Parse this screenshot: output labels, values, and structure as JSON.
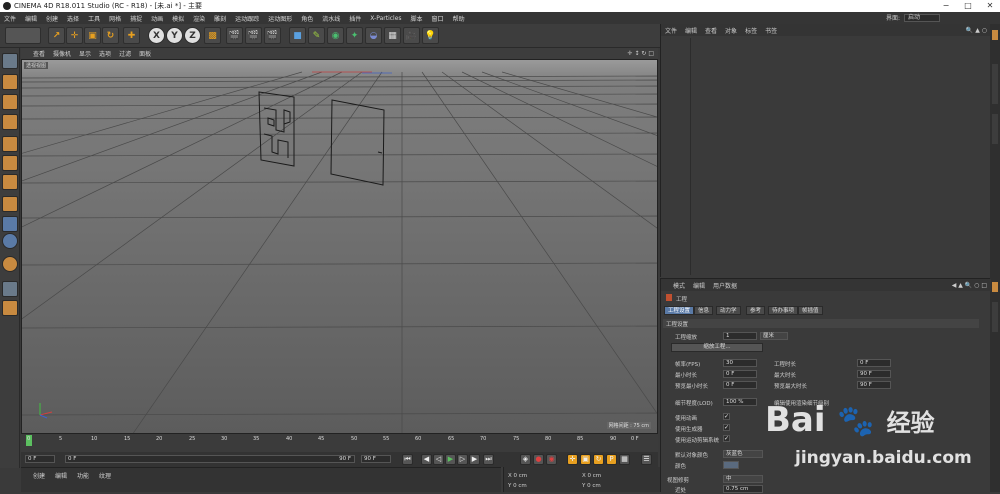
{
  "title_bar": {
    "text": "CINEMA 4D R18.011 Studio (RC - R18) - [未.ai *] - 主要",
    "min": "−",
    "max": "□",
    "close": "✕"
  },
  "menu": [
    "文件",
    "编辑",
    "创建",
    "选择",
    "工具",
    "网格",
    "捕捉",
    "动画",
    "模拟",
    "渲染",
    "雕刻",
    "运动跟踪",
    "运动图形",
    "角色",
    "流水线",
    "插件",
    "X-Particles",
    "脚本",
    "窗口",
    "帮助"
  ],
  "layout": {
    "label": "界面:",
    "value": "启动"
  },
  "toolbar": {
    "x": "X",
    "y": "Y",
    "z": "Z"
  },
  "viewport_menu": [
    "查看",
    "摄像机",
    "显示",
    "选项",
    "过滤",
    "面板"
  ],
  "viewport": {
    "label": "透视视图",
    "grid_info": "网格间距 : 75 cm"
  },
  "timeline": {
    "ticks": [
      "0",
      "5",
      "10",
      "15",
      "20",
      "25",
      "30",
      "35",
      "40",
      "45",
      "50",
      "55",
      "60",
      "65",
      "70",
      "75",
      "80",
      "85",
      "90"
    ],
    "end_frame": "0 F"
  },
  "transport": {
    "current": "0 F",
    "start": "0 F",
    "preview_end": "90 F",
    "end": "90 F"
  },
  "material_menu": [
    "创建",
    "编辑",
    "功能",
    "纹理"
  ],
  "coords": {
    "r1a": "X  0 cm",
    "r1b": "X  0 cm",
    "r2a": "Y  0 cm",
    "r2b": "Y  0 cm"
  },
  "object_manager": {
    "menu": [
      "文件",
      "编辑",
      "查看",
      "对象",
      "标签",
      "书签"
    ]
  },
  "attribute_manager": {
    "menu": [
      "模式",
      "编辑",
      "用户数据"
    ],
    "object_title": "工程",
    "tabs": [
      "工程设置",
      "信息",
      "动力学",
      "参考",
      "待办事项",
      "帧插值"
    ],
    "section": "工程设置",
    "scale_label": "工程缩放",
    "scale_value": "1",
    "scale_unit": "厘米",
    "scale_button": "缩放工程...",
    "fps_label": "帧率(FPS)",
    "fps_value": "30",
    "duration_label": "工程时长",
    "duration_value": "0 F",
    "min_label": "最小时长",
    "min_value": "0 F",
    "max_label": "最大时长",
    "max_value": "90 F",
    "pmin_label": "预览最小时长",
    "pmin_value": "0 F",
    "pmax_label": "预览最大时长",
    "pmax_value": "90 F",
    "lod_label": "细节程度(LOD)",
    "lod_value": "100 %",
    "lod_note": "编辑使用渲染细节级别",
    "chk1": "使用动画",
    "chk2": "使用生成器",
    "chk3": "使用运动剪辑系统",
    "default_color_label": "默认对象颜色",
    "default_color_value": "灰蓝色",
    "color_label": "颜色",
    "view_clip_label": "视图修剪",
    "view_clip_value": "中",
    "near_label": "近处",
    "near_value": "0.75 cm"
  },
  "watermark": {
    "brand": "Bai",
    "brand2": "经验",
    "url": "jingyan.baidu.com"
  }
}
